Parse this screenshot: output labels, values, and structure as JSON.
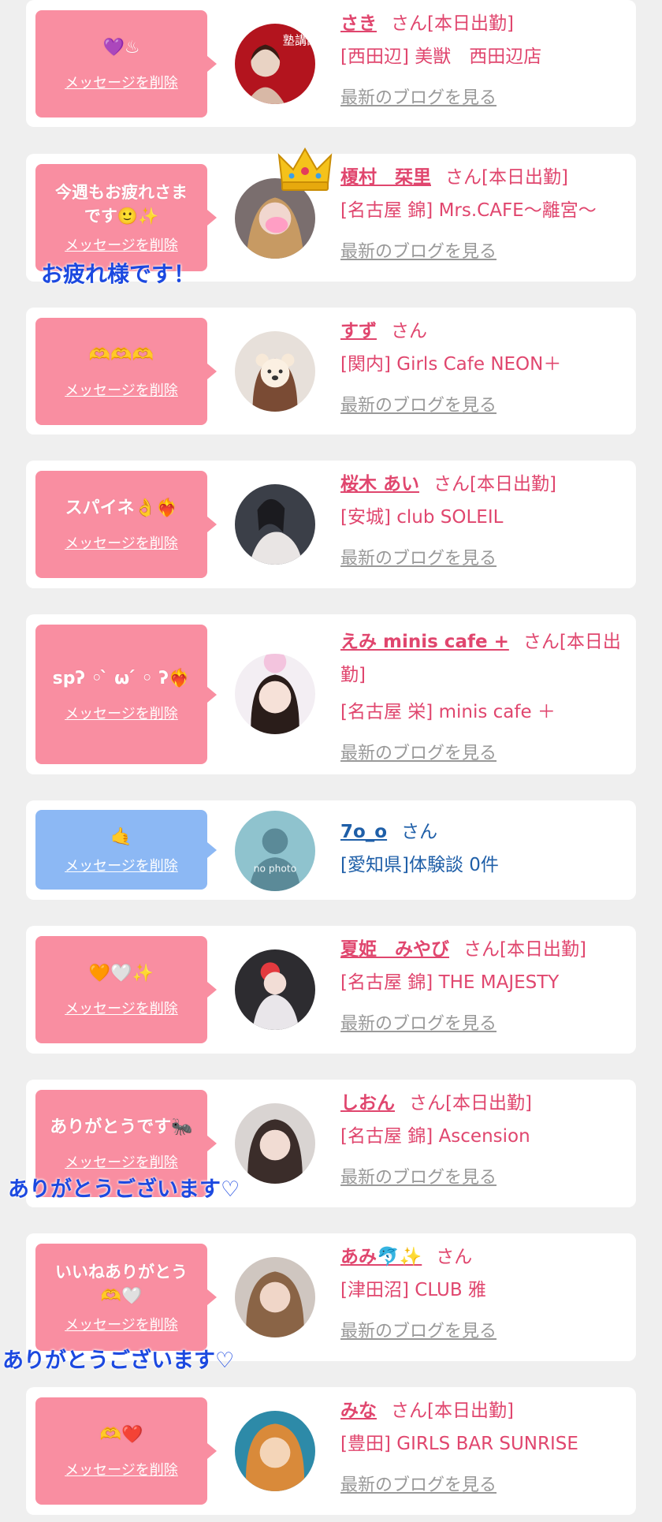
{
  "colors": {
    "accent": "#e0466e",
    "bubble_pink": "#f98ea1",
    "bubble_blue": "#8cb8f4",
    "blog_link": "#999999",
    "overlay_text": "#1c49e0",
    "page_bg": "#efefef"
  },
  "entries": [
    {
      "message": "💜♨",
      "delete_label": "メッセージを削除",
      "name": "さき",
      "suffix": "さん[本日出勤]",
      "shop": "[西田辺] 美獣　西田辺店",
      "blog": "最新のブログを見る",
      "avatar_icon": "profile-photo-icon",
      "avatar_text": "塾講師"
    },
    {
      "message": "今週もお疲れさま\nです🙂✨",
      "delete_label": "メッセージを削除",
      "name": "榎村　栞里",
      "suffix": "さん[本日出勤]",
      "shop": "[名古屋 錦] Mrs.CAFE～離宮～",
      "blog": "最新のブログを見る",
      "avatar_icon": "profile-photo-icon",
      "overlay": "お疲れ様です！",
      "crown_icon": "crown-icon"
    },
    {
      "message": "🫶🫶🫶",
      "delete_label": "メッセージを削除",
      "name": "すず",
      "suffix": "さん",
      "shop": "[関内] Girls Cafe NEON＋",
      "blog": "最新のブログを見る",
      "avatar_icon": "bear-face-photo-icon"
    },
    {
      "message": "スパイネ👌❤️‍🔥",
      "delete_label": "メッセージを削除",
      "name": "桜木 あい",
      "suffix": "さん[本日出勤]",
      "shop": "[安城] club SOLEIL",
      "blog": "最新のブログを見る",
      "avatar_icon": "profile-photo-icon"
    },
    {
      "message": "spʔ ◦ ̀ ω ́ ◦ ʔ❤️‍🔥",
      "delete_label": "メッセージを削除",
      "name": "えみ minis cafe +",
      "suffix": "さん[本日出勤]",
      "shop": "[名古屋 栄] minis cafe ＋",
      "blog": "最新のブログを見る",
      "avatar_icon": "profile-photo-icon"
    },
    {
      "message": "🤙",
      "delete_label": "メッセージを削除",
      "name": "7o_o",
      "suffix": "さん",
      "shop": "[愛知県]体験談 0件",
      "avatar_icon": "no-photo-silhouette-icon",
      "avatar_text": "no photo"
    },
    {
      "message": "🧡🤍✨",
      "delete_label": "メッセージを削除",
      "name": "夏姫　みやび",
      "suffix": "さん[本日出勤]",
      "shop": "[名古屋 錦] THE MAJESTY",
      "blog": "最新のブログを見る",
      "avatar_icon": "profile-photo-icon"
    },
    {
      "message": "ありがとうです🐜",
      "delete_label": "メッセージを削除",
      "name": "しおん",
      "suffix": "さん[本日出勤]",
      "shop": "[名古屋 錦] Ascension",
      "blog": "最新のブログを見る",
      "avatar_icon": "profile-photo-icon",
      "overlay": "ありがとうございます♡"
    },
    {
      "message": "いいねありがとう\n🫶🤍",
      "delete_label": "メッセージを削除",
      "name": "あみ🐬✨",
      "suffix": "さん",
      "shop": "[津田沼] CLUB 雅",
      "blog": "最新のブログを見る",
      "avatar_icon": "profile-photo-icon",
      "overlay": "ありがとうございます♡"
    },
    {
      "message": "🫶❤️",
      "delete_label": "メッセージを削除",
      "name": "みな",
      "suffix": "さん[本日出勤]",
      "shop": "[豊田] GIRLS BAR SUNRISE",
      "blog": "最新のブログを見る",
      "avatar_icon": "profile-photo-icon"
    }
  ]
}
